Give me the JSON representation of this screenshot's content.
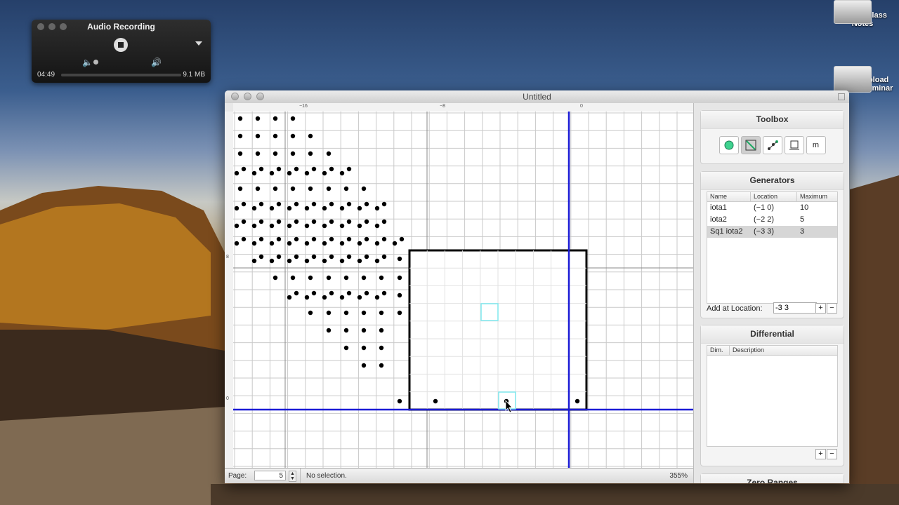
{
  "audio": {
    "title": "Audio Recording",
    "elapsed": "04:49",
    "filesize": "9.1 MB"
  },
  "desktop": {
    "icons": [
      {
        "label": "Upload Class Notes"
      },
      {
        "label": "Upload Seminar"
      }
    ]
  },
  "window": {
    "title": "Untitled",
    "ruler_labels": [
      "−16",
      "−8",
      "0"
    ],
    "ruler_left_labels": [
      "8",
      "0"
    ]
  },
  "toolbox": {
    "title": "Toolbox",
    "tools": [
      "dot-tool",
      "arrow-tool",
      "graph-tool",
      "box-tool",
      "m"
    ]
  },
  "generators": {
    "title": "Generators",
    "columns": [
      "Name",
      "Location",
      "Maximum"
    ],
    "rows": [
      {
        "name": "iota1",
        "location": "(−1 0)",
        "maximum": "10"
      },
      {
        "name": "iota2",
        "location": "(−2 2)",
        "maximum": "5"
      },
      {
        "name": "Sq1 iota2",
        "location": "(−3 3)",
        "maximum": "3"
      }
    ],
    "add_label": "Add at Location:",
    "add_value": "-3 3"
  },
  "differential": {
    "title": "Differential",
    "columns": [
      "Dim.",
      "Description"
    ]
  },
  "zero_ranges": {
    "title": "Zero Ranges"
  },
  "status": {
    "page_label": "Page:",
    "page_value": "5",
    "selection": "No selection.",
    "zoom": "355%"
  },
  "colors": {
    "axis_blue": "#1a1ad6",
    "highlight_cyan": "#7fe8ee",
    "grid": "#c9c9c9"
  }
}
